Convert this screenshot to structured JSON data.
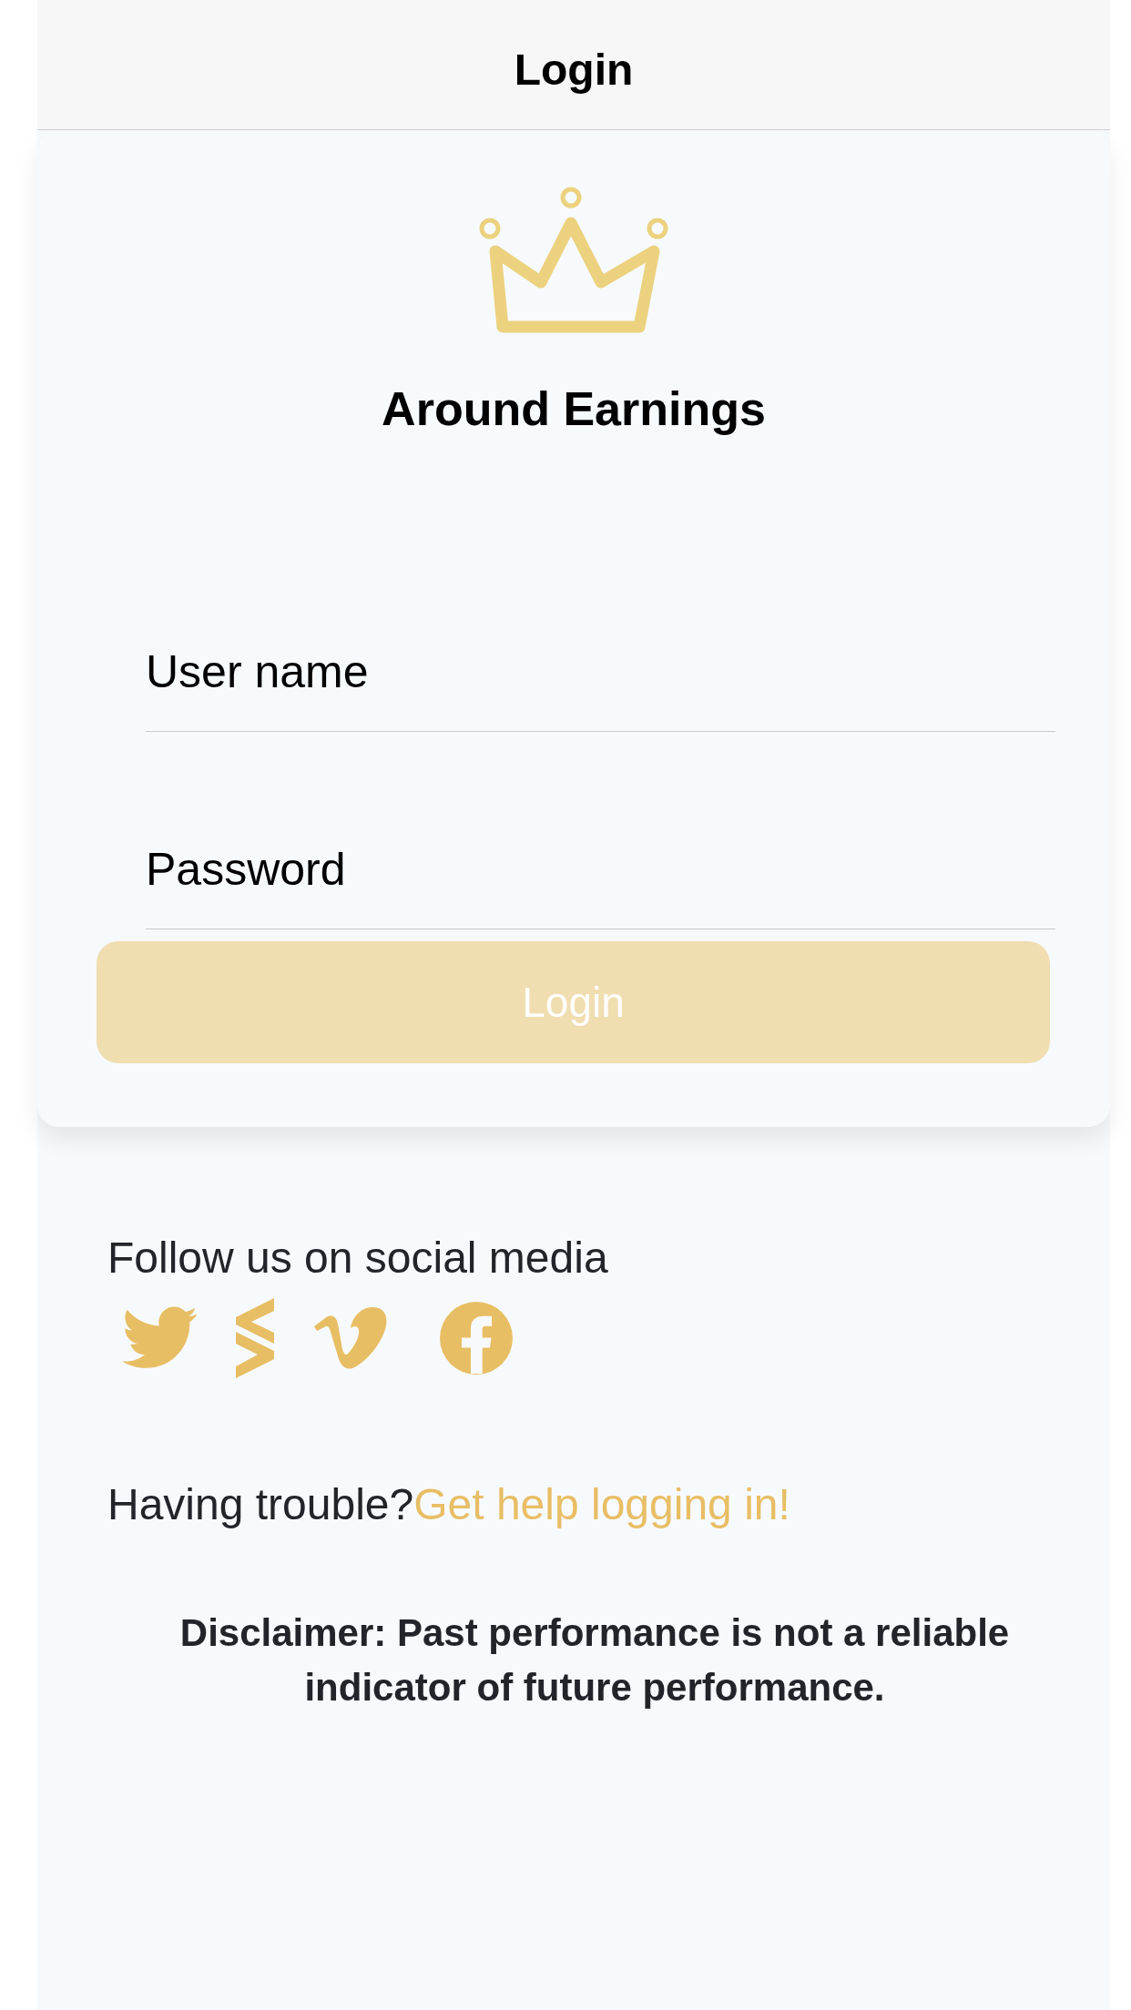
{
  "nav_bar": {
    "title": "Login"
  },
  "brand": {
    "name": "Around Earnings"
  },
  "form": {
    "fields": [
      {
        "placeholder": "User name"
      },
      {
        "placeholder": "Password"
      }
    ],
    "submit": {
      "label": "Login",
      "disabled": true
    }
  },
  "social": {
    "heading": "Follow us on social media"
  },
  "help": {
    "text": "Having trouble?",
    "link": "Get help logging in!"
  },
  "disclaimer": "Disclaimer: Past performance is not a reliable indicator of future performance."
}
